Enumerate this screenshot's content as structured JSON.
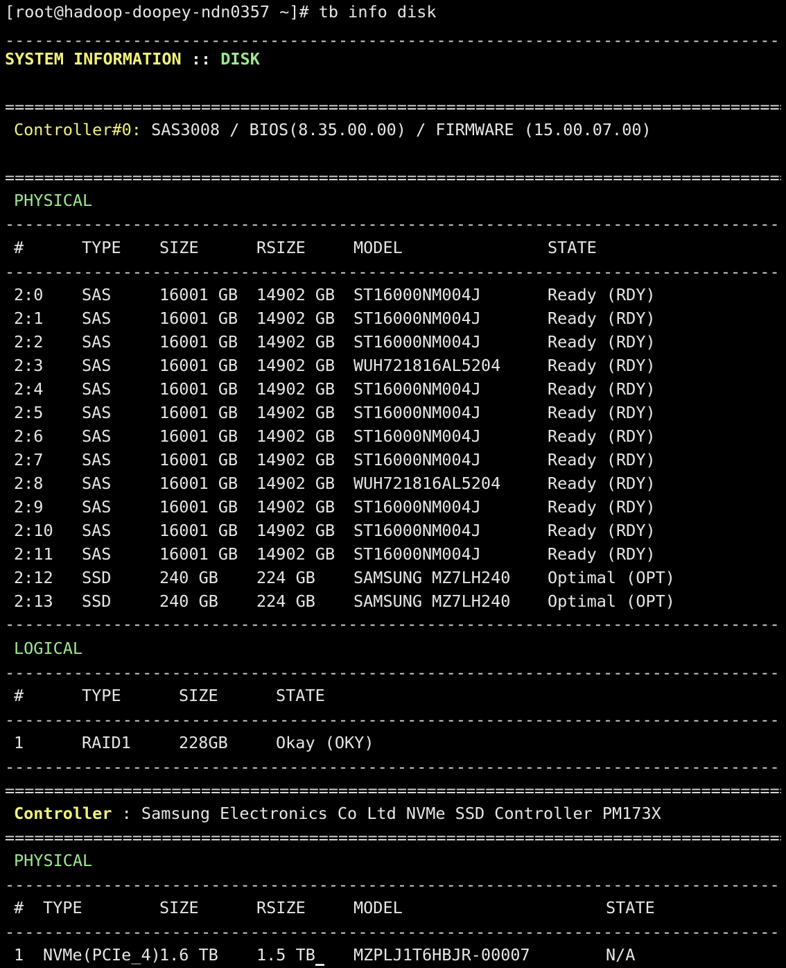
{
  "prompt": "[root@hadoop-doopey-ndn0357 ~]# tb info disk",
  "colors": {
    "background": "#000000",
    "text": "#e6e6e6",
    "heading_yellow": "#f2f27a",
    "heading_green": "#9de88f"
  },
  "header": {
    "title": "SYSTEM INFORMATION",
    "separator": " :: ",
    "section": "DISK"
  },
  "controller0": {
    "label": "Controller#0:",
    "info": " SAS3008 / BIOS(8.35.00.00) / FIRMWARE (15.00.07.00)"
  },
  "physical": {
    "heading": "PHYSICAL",
    "columns": [
      "#",
      "TYPE",
      "SIZE",
      "RSIZE",
      "MODEL",
      "STATE"
    ],
    "rows": [
      [
        "2:0",
        "SAS",
        "16001 GB",
        "14902 GB",
        "ST16000NM004J",
        "Ready (RDY)"
      ],
      [
        "2:1",
        "SAS",
        "16001 GB",
        "14902 GB",
        "ST16000NM004J",
        "Ready (RDY)"
      ],
      [
        "2:2",
        "SAS",
        "16001 GB",
        "14902 GB",
        "ST16000NM004J",
        "Ready (RDY)"
      ],
      [
        "2:3",
        "SAS",
        "16001 GB",
        "14902 GB",
        "WUH721816AL5204",
        "Ready (RDY)"
      ],
      [
        "2:4",
        "SAS",
        "16001 GB",
        "14902 GB",
        "ST16000NM004J",
        "Ready (RDY)"
      ],
      [
        "2:5",
        "SAS",
        "16001 GB",
        "14902 GB",
        "ST16000NM004J",
        "Ready (RDY)"
      ],
      [
        "2:6",
        "SAS",
        "16001 GB",
        "14902 GB",
        "ST16000NM004J",
        "Ready (RDY)"
      ],
      [
        "2:7",
        "SAS",
        "16001 GB",
        "14902 GB",
        "ST16000NM004J",
        "Ready (RDY)"
      ],
      [
        "2:8",
        "SAS",
        "16001 GB",
        "14902 GB",
        "WUH721816AL5204",
        "Ready (RDY)"
      ],
      [
        "2:9",
        "SAS",
        "16001 GB",
        "14902 GB",
        "ST16000NM004J",
        "Ready (RDY)"
      ],
      [
        "2:10",
        "SAS",
        "16001 GB",
        "14902 GB",
        "ST16000NM004J",
        "Ready (RDY)"
      ],
      [
        "2:11",
        "SAS",
        "16001 GB",
        "14902 GB",
        "ST16000NM004J",
        "Ready (RDY)"
      ],
      [
        "2:12",
        "SSD",
        "240 GB",
        "224 GB",
        "SAMSUNG MZ7LH240",
        "Optimal (OPT)"
      ],
      [
        "2:13",
        "SSD",
        "240 GB",
        "224 GB",
        "SAMSUNG MZ7LH240",
        "Optimal (OPT)"
      ]
    ]
  },
  "logical": {
    "heading": "LOGICAL",
    "columns": [
      "#",
      "TYPE",
      "SIZE",
      "STATE"
    ],
    "rows": [
      [
        "1",
        "RAID1",
        "228GB",
        "Okay (OKY)"
      ]
    ]
  },
  "controller1": {
    "label": "Controller",
    "info": " : Samsung Electronics Co Ltd NVMe SSD Controller PM173X"
  },
  "nvme_physical": {
    "heading": "PHYSICAL",
    "columns": [
      "#",
      "TYPE",
      "SIZE",
      "RSIZE",
      "MODEL",
      "STATE"
    ],
    "rows": [
      [
        "1",
        "NVMe(PCIe_4)",
        "1.6 TB",
        "1.5 TB",
        "MZPLJ1T6HBJR-00007",
        "N/A"
      ]
    ]
  }
}
